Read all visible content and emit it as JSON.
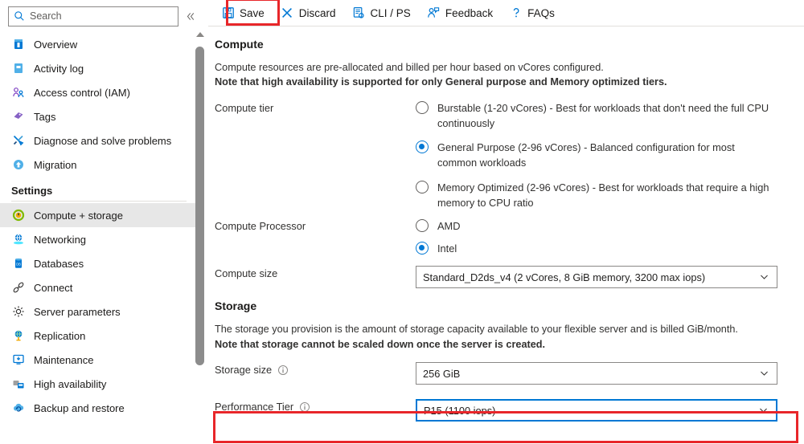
{
  "sidebar": {
    "search": {
      "placeholder": "Search",
      "value": "",
      "icon": "search-icon"
    },
    "collapse_icon": "chevron-double-left-icon",
    "items": [
      {
        "label": "Overview",
        "icon": "overview-icon",
        "selected": false
      },
      {
        "label": "Activity log",
        "icon": "activity-log-icon",
        "selected": false
      },
      {
        "label": "Access control (IAM)",
        "icon": "access-control-icon",
        "selected": false
      },
      {
        "label": "Tags",
        "icon": "tags-icon",
        "selected": false
      },
      {
        "label": "Diagnose and solve problems",
        "icon": "diagnose-icon",
        "selected": false
      },
      {
        "label": "Migration",
        "icon": "migration-icon",
        "selected": false
      }
    ],
    "group_label": "Settings",
    "settings_items": [
      {
        "label": "Compute + storage",
        "icon": "compute-storage-icon",
        "selected": true
      },
      {
        "label": "Networking",
        "icon": "networking-icon",
        "selected": false
      },
      {
        "label": "Databases",
        "icon": "databases-icon",
        "selected": false
      },
      {
        "label": "Connect",
        "icon": "connect-icon",
        "selected": false
      },
      {
        "label": "Server parameters",
        "icon": "server-parameters-icon",
        "selected": false
      },
      {
        "label": "Replication",
        "icon": "replication-icon",
        "selected": false
      },
      {
        "label": "Maintenance",
        "icon": "maintenance-icon",
        "selected": false
      },
      {
        "label": "High availability",
        "icon": "high-availability-icon",
        "selected": false
      },
      {
        "label": "Backup and restore",
        "icon": "backup-restore-icon",
        "selected": false
      }
    ]
  },
  "toolbar": {
    "buttons": [
      {
        "label": "Save",
        "icon": "save-disk-icon",
        "highlighted": true
      },
      {
        "label": "Discard",
        "icon": "close-x-icon",
        "highlighted": false
      },
      {
        "label": "CLI / PS",
        "icon": "cli-script-icon",
        "highlighted": false
      },
      {
        "label": "Feedback",
        "icon": "feedback-person-icon",
        "highlighted": false
      },
      {
        "label": "FAQs",
        "icon": "question-mark-icon",
        "highlighted": false
      }
    ]
  },
  "compute": {
    "title": "Compute",
    "desc_line1": "Compute resources are pre-allocated and billed per hour based on vCores configured.",
    "desc_line2_bold": "Note that high availability is supported for only General purpose and Memory optimized tiers.",
    "tier_label": "Compute tier",
    "tier_options": [
      {
        "text": "Burstable (1-20 vCores) - Best for workloads that don't need the full CPU continuously",
        "selected": false
      },
      {
        "text": "General Purpose (2-96 vCores) - Balanced configuration for most common workloads",
        "selected": true
      },
      {
        "text": "Memory Optimized (2-96 vCores) - Best for workloads that require a high memory to CPU ratio",
        "selected": false
      }
    ],
    "processor_label": "Compute Processor",
    "processor_options": [
      {
        "text": "AMD",
        "selected": false
      },
      {
        "text": "Intel",
        "selected": true
      }
    ],
    "size_label": "Compute size",
    "size_value": "Standard_D2ds_v4 (2 vCores, 8 GiB memory, 3200 max iops)"
  },
  "storage": {
    "title": "Storage",
    "desc_line1": "The storage you provision is the amount of storage capacity available to your flexible server and is billed GiB/month.",
    "desc_line2_bold": "Note that storage cannot be scaled down once the server is created.",
    "size_label": "Storage size",
    "size_value": "256 GiB",
    "perf_label": "Performance Tier",
    "perf_value": "P15 (1100 iops)",
    "info_icon": "info-icon"
  },
  "colors": {
    "accent": "#0078d4",
    "annotation": "#e8262a",
    "selected_row": "#e7e7e7",
    "border": "#8a8886"
  }
}
